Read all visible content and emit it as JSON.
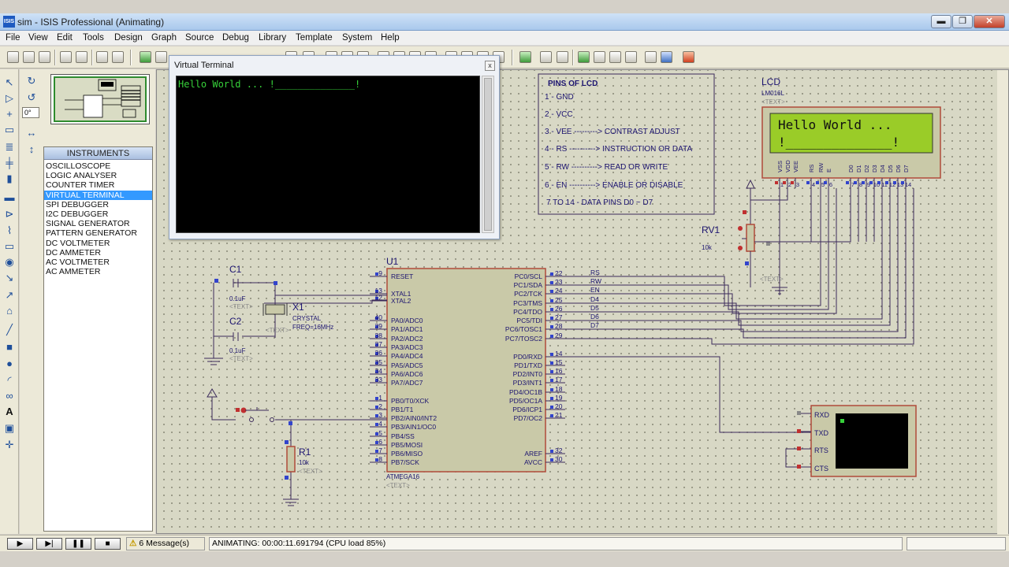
{
  "window": {
    "title": "sim - ISIS Professional (Animating)",
    "app_icon": "ISIS",
    "minimize": "▬",
    "maximize": "❐",
    "close": "✕"
  },
  "menu": [
    "File",
    "View",
    "Edit",
    "Tools",
    "Design",
    "Graph",
    "Source",
    "Debug",
    "Library",
    "Template",
    "System",
    "Help"
  ],
  "sidebar": {
    "angle": "0°",
    "instruments_title": "INSTRUMENTS",
    "instruments": [
      "OSCILLOSCOPE",
      "LOGIC ANALYSER",
      "COUNTER TIMER",
      "VIRTUAL TERMINAL",
      "SPI DEBUGGER",
      "I2C DEBUGGER",
      "SIGNAL GENERATOR",
      "PATTERN GENERATOR",
      "DC VOLTMETER",
      "DC AMMETER",
      "AC VOLTMETER",
      "AC AMMETER"
    ],
    "selected": "VIRTUAL TERMINAL"
  },
  "virtual_terminal": {
    "title": "Virtual Terminal",
    "close": "x",
    "text": "Hello World ... !______________!"
  },
  "lcd_pins_note": {
    "title": "PINS OF LCD",
    "lines": [
      "1 - GND",
      "2 - VCC",
      "3 - VEE ---------> CONTRAST ADJUST",
      "4 - RS ----------> INSTRUCTION OR DATA",
      "5 - RW ----------> READ OR WRITE",
      "6 - EN ----------> ENABLE OR DISABLE",
      "7 TO 14 - DATA PINS D0 ~ D7"
    ]
  },
  "lcd": {
    "ref": "LCD",
    "part": "LM016L",
    "text_tag": "<TEXT>",
    "line1": "Hello World ...",
    "line2": "!______________!",
    "pin_labels": [
      "VSS",
      "VDD",
      "VEE",
      "RS",
      "RW",
      "E",
      "D0",
      "D1",
      "D2",
      "D3",
      "D4",
      "D5",
      "D6",
      "D7"
    ],
    "pin_numbers": [
      "1",
      "2",
      "3",
      "4",
      "5",
      "6",
      "7",
      "8",
      "9",
      "10",
      "11",
      "12",
      "13",
      "14"
    ]
  },
  "rv1": {
    "ref": "RV1",
    "value": "10k",
    "text_tag": "<TEXT>"
  },
  "mcu": {
    "ref": "U1",
    "part": "ATMEGA16",
    "text_tag": "<TEXT>",
    "left_pins": [
      {
        "num": "9",
        "name": "RESET"
      },
      {
        "num": "13",
        "name": "XTAL1"
      },
      {
        "num": "12",
        "name": "XTAL2"
      },
      {
        "num": "40",
        "name": "PA0/ADC0"
      },
      {
        "num": "39",
        "name": "PA1/ADC1"
      },
      {
        "num": "38",
        "name": "PA2/ADC2"
      },
      {
        "num": "37",
        "name": "PA3/ADC3"
      },
      {
        "num": "36",
        "name": "PA4/ADC4"
      },
      {
        "num": "35",
        "name": "PA5/ADC5"
      },
      {
        "num": "34",
        "name": "PA6/ADC6"
      },
      {
        "num": "33",
        "name": "PA7/ADC7"
      },
      {
        "num": "1",
        "name": "PB0/T0/XCK"
      },
      {
        "num": "2",
        "name": "PB1/T1"
      },
      {
        "num": "3",
        "name": "PB2/AIN0/INT2"
      },
      {
        "num": "4",
        "name": "PB3/AIN1/OC0"
      },
      {
        "num": "5",
        "name": "PB4/SS"
      },
      {
        "num": "6",
        "name": "PB5/MOSI"
      },
      {
        "num": "7",
        "name": "PB6/MISO"
      },
      {
        "num": "8",
        "name": "PB7/SCK"
      }
    ],
    "right_pins": [
      {
        "num": "22",
        "name": "PC0/SCL"
      },
      {
        "num": "23",
        "name": "PC1/SDA"
      },
      {
        "num": "24",
        "name": "PC2/TCK"
      },
      {
        "num": "25",
        "name": "PC3/TMS"
      },
      {
        "num": "26",
        "name": "PC4/TDO"
      },
      {
        "num": "27",
        "name": "PC5/TDI"
      },
      {
        "num": "28",
        "name": "PC6/TOSC1"
      },
      {
        "num": "29",
        "name": "PC7/TOSC2"
      },
      {
        "num": "14",
        "name": "PD0/RXD"
      },
      {
        "num": "15",
        "name": "PD1/TXD"
      },
      {
        "num": "16",
        "name": "PD2/INT0"
      },
      {
        "num": "17",
        "name": "PD3/INT1"
      },
      {
        "num": "18",
        "name": "PD4/OC1B"
      },
      {
        "num": "19",
        "name": "PD5/OC1A"
      },
      {
        "num": "20",
        "name": "PD6/ICP1"
      },
      {
        "num": "21",
        "name": "PD7/OC2"
      },
      {
        "num": "32",
        "name": "AREF"
      },
      {
        "num": "30",
        "name": "AVCC"
      }
    ],
    "net_labels": [
      "RS",
      "RW",
      "EN",
      "D4",
      "D5",
      "D6",
      "D7"
    ]
  },
  "c1": {
    "ref": "C1",
    "value": "0.1uF",
    "text_tag": "<TEXT>"
  },
  "c2": {
    "ref": "C2",
    "value": "0.1uF",
    "text_tag": "<TEXT>"
  },
  "x1": {
    "ref": "X1",
    "part": "CRYSTAL",
    "freq": "FREQ=16MHz",
    "text_tag": "<TEXT>"
  },
  "r1": {
    "ref": "R1",
    "value": "10k",
    "text_tag": "<TEXT>"
  },
  "terminal_instrument": {
    "pins": [
      "RXD",
      "TXD",
      "RTS",
      "CTS"
    ]
  },
  "statusbar": {
    "play": "▶",
    "step": "▶|",
    "pause": "❚❚",
    "stop": "■",
    "messages": "6 Message(s)",
    "status": "ANIMATING: 00:00:11.691794 (CPU load 85%)"
  },
  "colors": {
    "canvas": "#d8d8c5",
    "wire": "#3b2a5a",
    "component_outline": "#b04a3a",
    "component_fill": "#c9c9a8",
    "lcd_screen": "#9acc28",
    "terminal_text": "#37d13a"
  }
}
